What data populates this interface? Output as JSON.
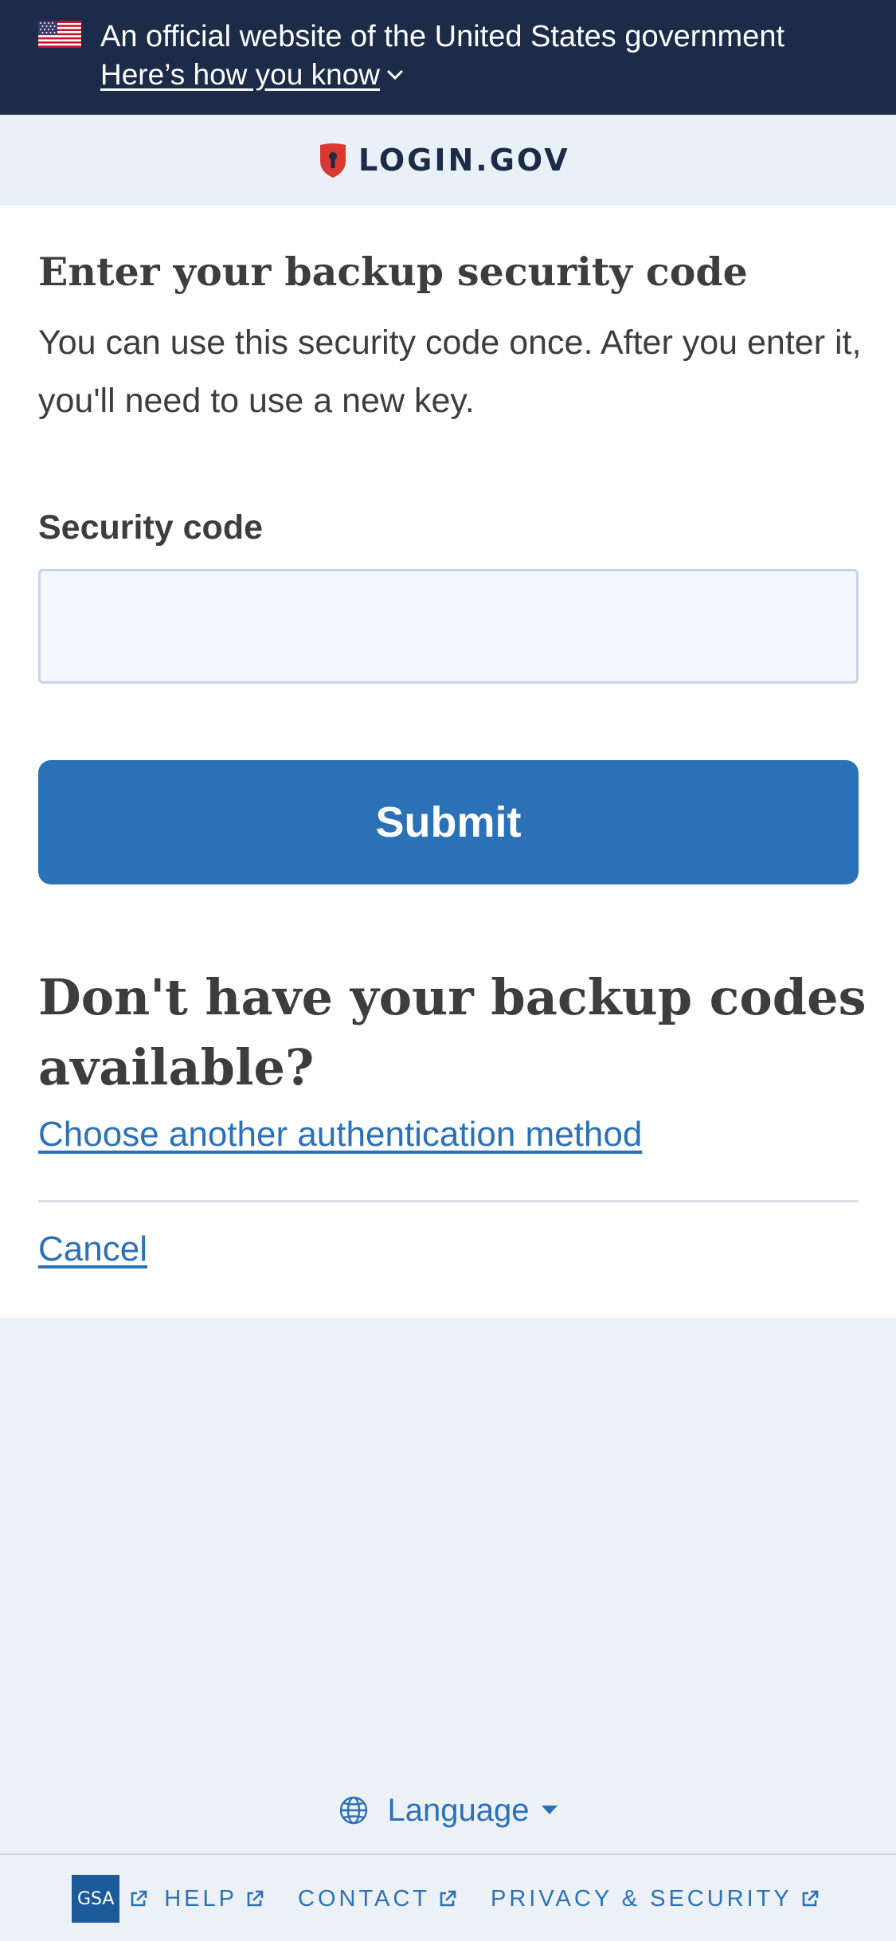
{
  "gov_banner": {
    "text": "An official website of the United States government",
    "link_text": "Here’s how you know"
  },
  "logo": {
    "text": "LOGIN.GOV"
  },
  "main": {
    "heading": "Enter your backup security code",
    "intro": "You can use this security code once. After you enter it, you'll need to use a new key.",
    "field_label": "Security code",
    "field_value": "",
    "submit_label": "Submit",
    "alt_heading": "Don't have your backup codes available?",
    "alt_link": "Choose another authentication method",
    "cancel_link": "Cancel"
  },
  "language": {
    "label": "Language"
  },
  "footer": {
    "gsa_logo_text": "GSA",
    "links": [
      "HELP",
      "CONTACT",
      "PRIVACY & SECURITY"
    ]
  },
  "colors": {
    "banner_bg": "#1b2b48",
    "link_blue": "#2b71b7",
    "page_bg": "#ecf1f7",
    "shield_red": "#d83933"
  },
  "icons": [
    "us-flag-icon",
    "chevron-down-icon",
    "shield-lock-icon",
    "globe-icon",
    "caret-down-icon",
    "external-link-icon"
  ]
}
